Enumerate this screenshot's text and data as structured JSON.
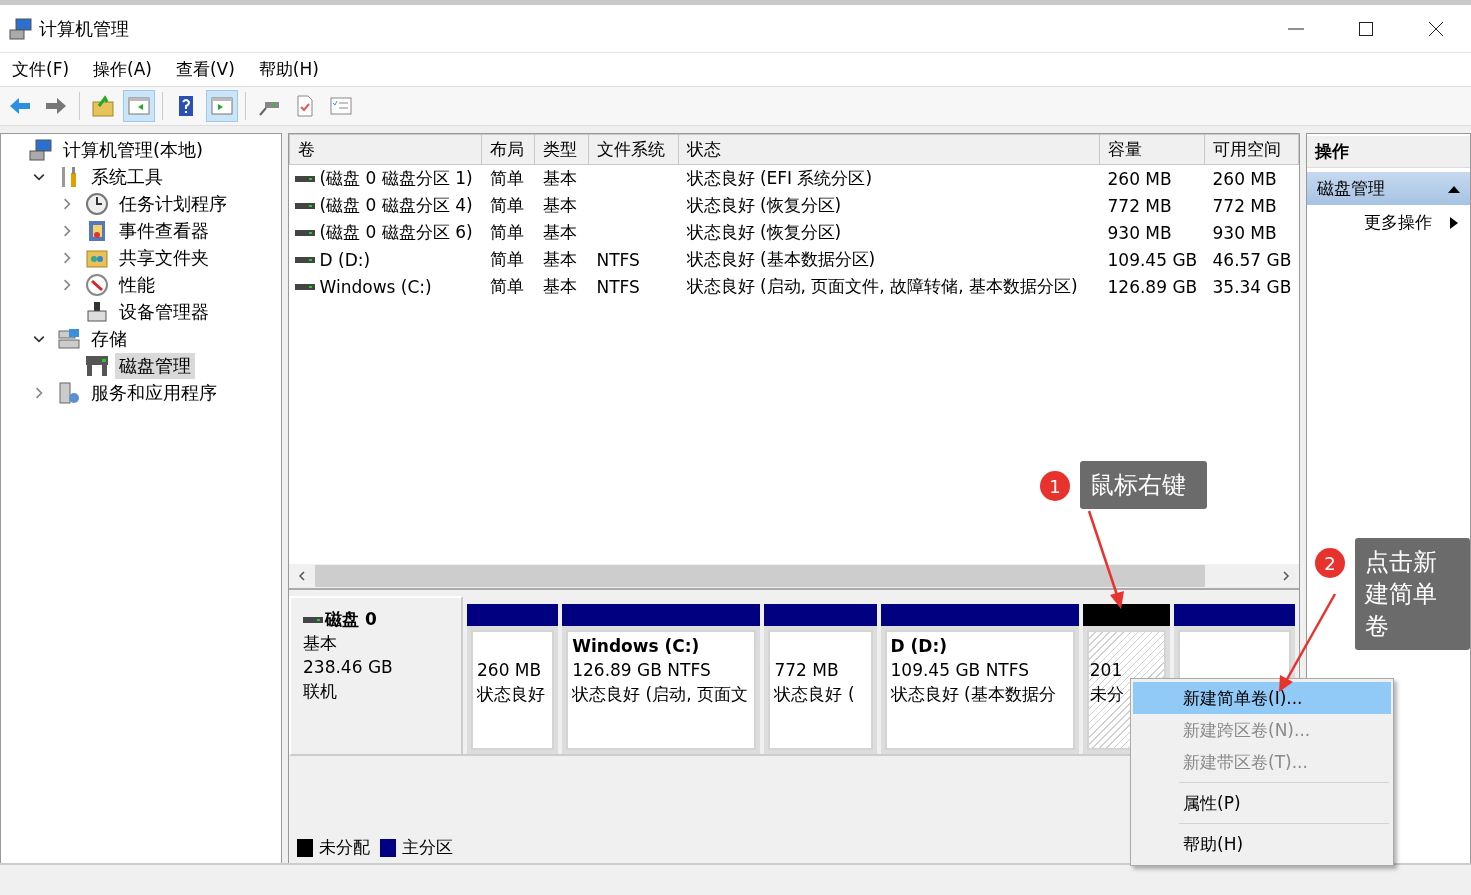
{
  "window": {
    "title": "计算机管理"
  },
  "menu": [
    "文件(F)",
    "操作(A)",
    "查看(V)",
    "帮助(H)"
  ],
  "toolbar": [
    {
      "kind": "back"
    },
    {
      "kind": "forward"
    },
    {
      "kind": "up"
    },
    {
      "kind": "tree-pane",
      "on": true
    },
    {
      "kind": "help"
    },
    {
      "kind": "action-pane",
      "on": true
    },
    {
      "kind": "connect"
    },
    {
      "kind": "check"
    },
    {
      "kind": "list"
    }
  ],
  "tree": [
    {
      "label": "计算机管理(本地)",
      "selected": false,
      "children": [
        {
          "label": "系统工具",
          "expanded": true,
          "selected": false,
          "children": [
            {
              "label": "任务计划程序",
              "expanded": false,
              "selected": false
            },
            {
              "label": "事件查看器",
              "expanded": false,
              "selected": false
            },
            {
              "label": "共享文件夹",
              "expanded": false,
              "selected": false
            },
            {
              "label": "性能",
              "expanded": false,
              "selected": false
            },
            {
              "label": "设备管理器",
              "selected": false
            }
          ]
        },
        {
          "label": "存储",
          "expanded": true,
          "selected": false,
          "children": [
            {
              "label": "磁盘管理",
              "selected": true
            }
          ]
        },
        {
          "label": "服务和应用程序",
          "expanded": false,
          "selected": false
        }
      ]
    }
  ],
  "table": {
    "columns": [
      "卷",
      "布局",
      "类型",
      "文件系统",
      "状态",
      "容量",
      "可用空间"
    ],
    "rows": [
      {
        "volume": "(磁盘 0 磁盘分区 1)",
        "layout": "简单",
        "type": "基本",
        "status": "状态良好 (EFI 系统分区)",
        "capacity": "260 MB",
        "free": "260 MB"
      },
      {
        "volume": "(磁盘 0 磁盘分区 4)",
        "layout": "简单",
        "type": "基本",
        "status": "状态良好 (恢复分区)",
        "capacity": "772 MB",
        "free": "772 MB"
      },
      {
        "volume": "(磁盘 0 磁盘分区 6)",
        "layout": "简单",
        "type": "基本",
        "status": "状态良好 (恢复分区)",
        "capacity": "930 MB",
        "free": "930 MB"
      },
      {
        "volume": "D (D:)",
        "layout": "简单",
        "type": "基本",
        "filesystem": "NTFS",
        "status": "状态良好 (基本数据分区)",
        "capacity": "109.45 GB",
        "free": "46.57 GB"
      },
      {
        "volume": "Windows  (C:)",
        "layout": "简单",
        "type": "基本",
        "filesystem": "NTFS",
        "status": "状态良好 (启动, 页面文件, 故障转储, 基本数据分区)",
        "capacity": "126.89 GB",
        "free": "35.34 GB"
      }
    ]
  },
  "disk": {
    "name": "磁盘 0",
    "type": "基本",
    "size": "238.46 GB",
    "status": "联机",
    "partitions": [
      {
        "kind": "primary",
        "size": "260 MB",
        "status": "状态良好"
      },
      {
        "kind": "primary",
        "title": "Windows   (C:)",
        "size": "126.89 GB NTFS",
        "status": "状态良好 (启动, 页面文"
      },
      {
        "kind": "primary",
        "size": "772 MB",
        "status": "状态良好 ("
      },
      {
        "kind": "primary",
        "title": "D  (D:)",
        "size": "109.45 GB NTFS",
        "status": "状态良好 (基本数据分"
      },
      {
        "kind": "unallocated",
        "size": "201",
        "status": "未分"
      },
      {
        "kind": "primary"
      }
    ]
  },
  "legend": [
    {
      "kind": "unallocated",
      "label": "未分配",
      "color": "#000000"
    },
    {
      "kind": "primary",
      "label": "主分区",
      "color": "#000080"
    }
  ],
  "actions": {
    "title": "操作",
    "items": [
      {
        "kind": "section",
        "label": "磁盘管理",
        "expanded": true
      },
      {
        "kind": "submenu",
        "label": "更多操作"
      }
    ]
  },
  "context_menu": [
    {
      "kind": "item",
      "label": "新建简单卷(I)...",
      "selected": true,
      "disabled": false
    },
    {
      "kind": "item",
      "label": "新建跨区卷(N)...",
      "selected": false,
      "disabled": true
    },
    {
      "kind": "item",
      "label": "新建带区卷(T)...",
      "selected": false,
      "disabled": true
    },
    {
      "kind": "separator"
    },
    {
      "kind": "item",
      "label": "属性(P)",
      "selected": false,
      "disabled": false
    },
    {
      "kind": "separator"
    },
    {
      "kind": "item",
      "label": "帮助(H)",
      "selected": false,
      "disabled": false
    }
  ],
  "callouts": [
    {
      "number": "1",
      "text": "鼠标右键"
    },
    {
      "number": "2",
      "text": "点击新建简单卷"
    }
  ]
}
